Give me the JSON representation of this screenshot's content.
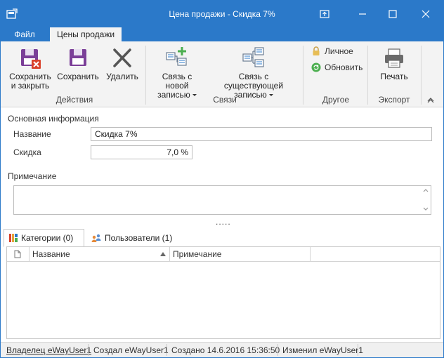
{
  "window": {
    "title": "Цена продажи - Скидка 7%"
  },
  "ribbon_tabs": [
    {
      "label": "Файл"
    },
    {
      "label": "Цены продажи"
    }
  ],
  "ribbon": {
    "groups": {
      "actions": "Действия",
      "links": "Связи",
      "other": "Другое",
      "export": "Экспорт"
    },
    "buttons": {
      "save_close_line1": "Сохранить",
      "save_close_line2": "и закрыть",
      "save": "Сохранить",
      "delete": "Удалить",
      "link_new_line1": "Связь с новой",
      "link_new_line2": "записью",
      "link_existing_line1": "Связь с существующей",
      "link_existing_line2": "записью",
      "personal": "Личное",
      "refresh": "Обновить",
      "print": "Печать"
    }
  },
  "form": {
    "section_title": "Основная информация",
    "name_label": "Название",
    "name_value": "Скидка 7%",
    "discount_label": "Скидка",
    "discount_value": "7,0 %",
    "note_label": "Примечание",
    "note_value": ""
  },
  "splitter": ".....",
  "tabs": [
    {
      "label": "Категории (0)"
    },
    {
      "label": "Пользователи (1)"
    }
  ],
  "grid": {
    "columns": [
      {
        "label": ""
      },
      {
        "label": "Название"
      },
      {
        "label": "Примечание"
      }
    ],
    "rows": []
  },
  "status": {
    "owner": "Владелец eWayUser1",
    "created_by": "Создал eWayUser1",
    "created_at": "Создано 14.6.2016 15:36:50",
    "modified_by": "Изменил eWayUser1"
  },
  "colors": {
    "accent": "#2b79c9",
    "ribbon_bg": "#f3f3f3",
    "delete_red": "#d9412b",
    "save_purple": "#7b3f98",
    "link_green": "#4caf50"
  }
}
